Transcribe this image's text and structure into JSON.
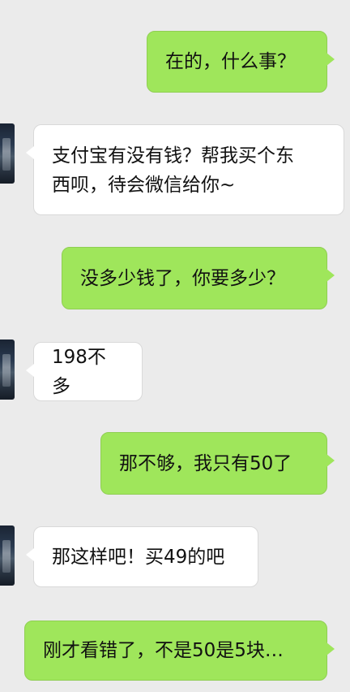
{
  "messages": [
    {
      "side": "sent",
      "text": "在的，什么事？"
    },
    {
      "side": "received",
      "text": "支付宝有没有钱？帮我买个东\n西呗，待会微信给你~"
    },
    {
      "side": "sent",
      "text": "没多少钱了，你要多少？"
    },
    {
      "side": "received",
      "text": "198不多"
    },
    {
      "side": "sent",
      "text": "那不够，我只有50了"
    },
    {
      "side": "received",
      "text": "那这样吧！买49的吧"
    },
    {
      "side": "sent",
      "text": "刚才看错了，不是50是5块…"
    }
  ],
  "colors": {
    "background": "#ebebeb",
    "sent_bubble": "#9fe65b",
    "received_bubble": "#ffffff"
  }
}
